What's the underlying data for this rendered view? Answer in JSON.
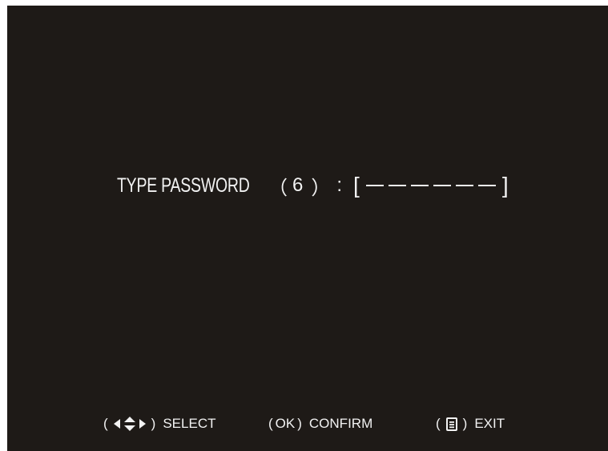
{
  "password_prompt": {
    "label": "TYPE PASSWORD",
    "open_paren": "（",
    "digit_count": "6",
    "close_paren": "）",
    "colon": ":",
    "open_bracket": "[",
    "close_bracket": "]",
    "entered_digits": 0,
    "slots": [
      "",
      "",
      "",
      "",
      "",
      ""
    ]
  },
  "footer": {
    "select": {
      "open": "(",
      "close": ")",
      "label": "SELECT",
      "icon": "arrows-icon"
    },
    "confirm": {
      "open": "(",
      "key": "OK",
      "close": ")",
      "label": "CONFIRM"
    },
    "exit": {
      "open": "(",
      "close": ")",
      "label": "EXIT",
      "icon": "menu-icon"
    }
  },
  "colors": {
    "background": "#1e1a17",
    "text": "#f2f2f2"
  }
}
